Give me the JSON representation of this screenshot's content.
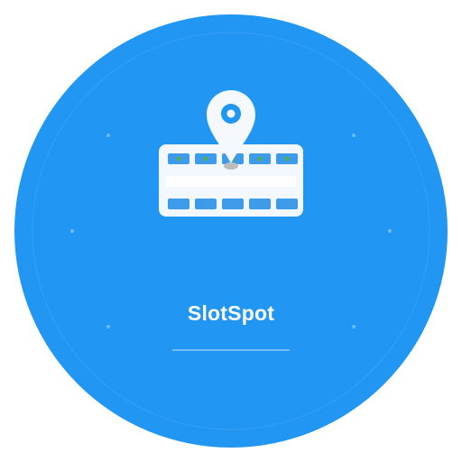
{
  "app": {
    "name": "SlotSpot"
  },
  "colors": {
    "background_circle": "#2196F3",
    "parking_lot_body": "#F3F8FE",
    "parking_slot": "#3D9BEA",
    "available_dot": "#4CAF50",
    "pin": "#F5F9FE",
    "pin_shadow": "#BDBDBD",
    "underline": "#90CAF9"
  },
  "icons": {
    "main": "parking-lot-icon",
    "pin": "location-pin-icon"
  }
}
